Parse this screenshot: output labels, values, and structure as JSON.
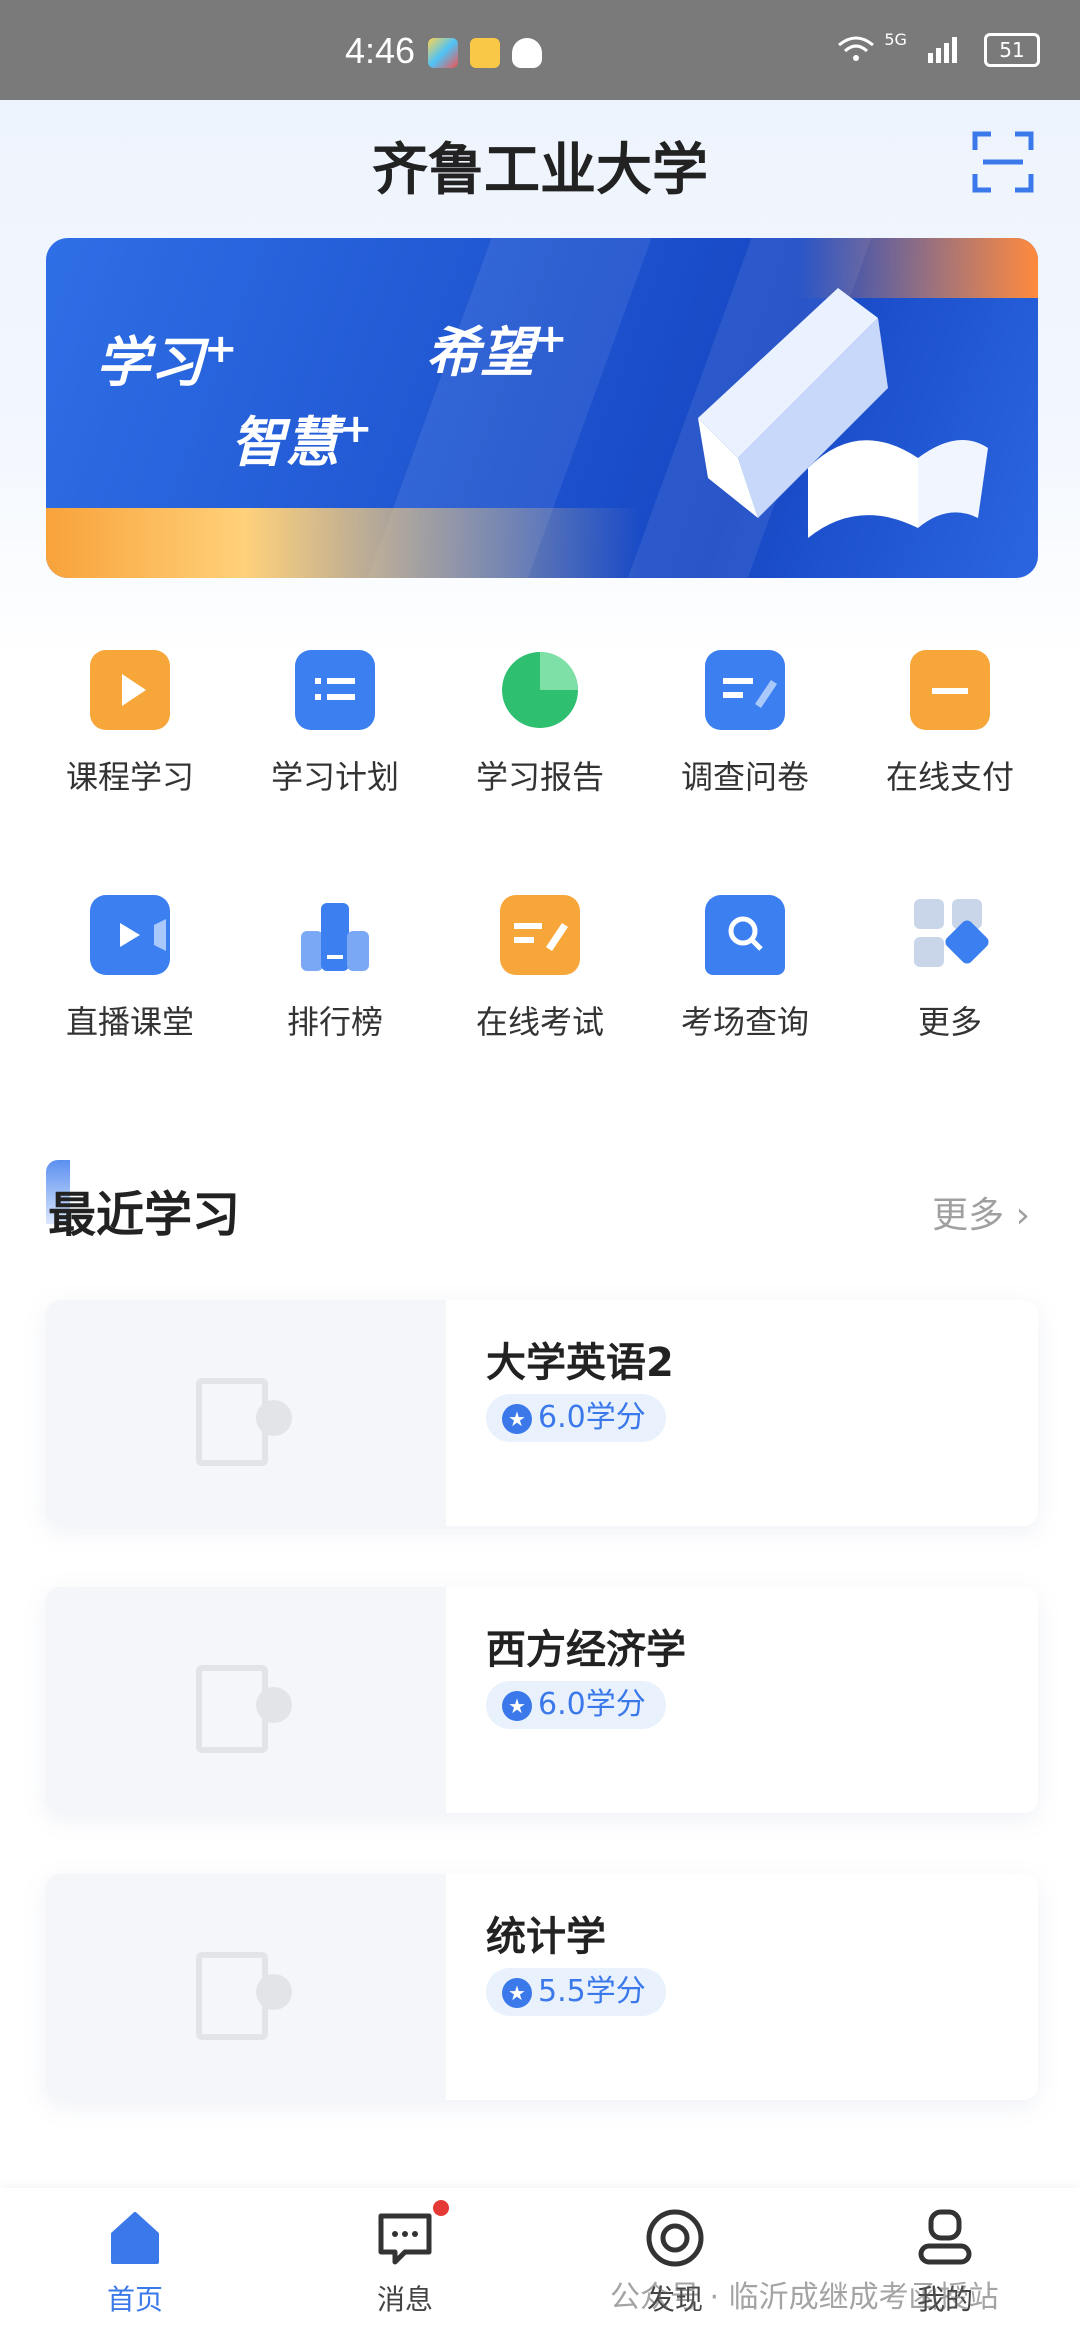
{
  "status_bar": {
    "time": "4:46",
    "battery": "51",
    "network": "5G"
  },
  "header": {
    "title": "齐鲁工业大学"
  },
  "banner": {
    "word1": "学习",
    "word2": "智慧",
    "word3": "希望",
    "plus": "+"
  },
  "grid": [
    {
      "label": "课程学习",
      "icon": "play-icon",
      "color": "#f7a63a"
    },
    {
      "label": "学习计划",
      "icon": "list-calendar-icon",
      "color": "#3b7ff0"
    },
    {
      "label": "学习报告",
      "icon": "pie-chart-icon",
      "color": "#2fbf71"
    },
    {
      "label": "调查问卷",
      "icon": "survey-icon",
      "color": "#3b7ff0"
    },
    {
      "label": "在线支付",
      "icon": "card-icon",
      "color": "#f7a63a"
    },
    {
      "label": "直播课堂",
      "icon": "live-camera-icon",
      "color": "#3b7ff0"
    },
    {
      "label": "排行榜",
      "icon": "ranking-icon",
      "color": "#3b7ff0"
    },
    {
      "label": "在线考试",
      "icon": "exam-icon",
      "color": "#f7a63a"
    },
    {
      "label": "考场查询",
      "icon": "search-seat-icon",
      "color": "#3b7ff0"
    },
    {
      "label": "更多",
      "icon": "more-apps-icon",
      "color": "#3b7ff0"
    }
  ],
  "recent": {
    "title": "最近学习",
    "more": "更多",
    "courses": [
      {
        "name": "大学英语2",
        "credit": "6.0学分"
      },
      {
        "name": "西方经济学",
        "credit": "6.0学分"
      },
      {
        "name": "统计学",
        "credit": "5.5学分"
      }
    ]
  },
  "tabs": [
    {
      "label": "首页",
      "icon": "home-icon"
    },
    {
      "label": "消息",
      "icon": "message-icon"
    },
    {
      "label": "发现",
      "icon": "discover-icon"
    },
    {
      "label": "我的",
      "icon": "profile-icon"
    }
  ],
  "watermark": "公众号 · 临沂成继成考函授站",
  "colors": {
    "accent": "#3b79ea",
    "orange": "#f7a63a",
    "badge": "#e53935"
  }
}
